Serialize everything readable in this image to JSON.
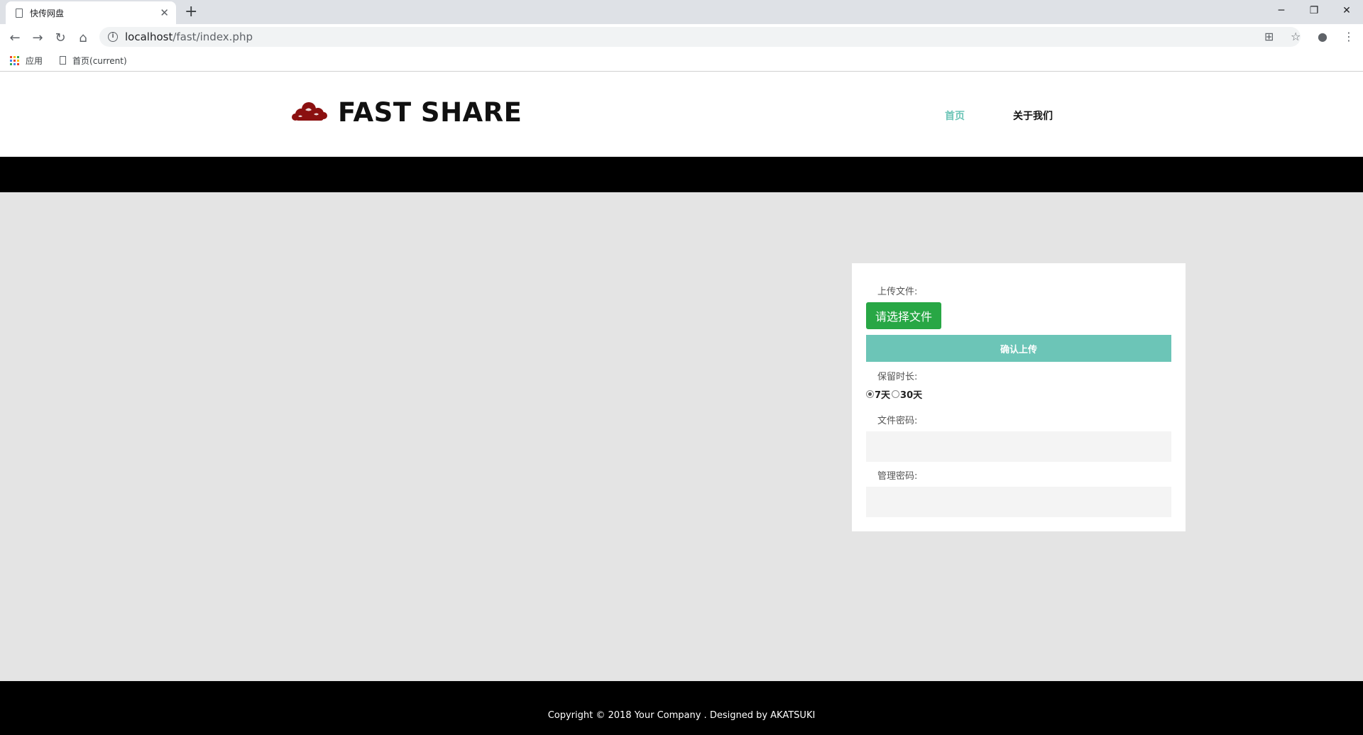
{
  "browser": {
    "tab_title": "快传网盘",
    "tab_close": "✕",
    "new_tab": "+",
    "window_controls": {
      "minimize": "─",
      "restore": "❐",
      "close": "✕"
    },
    "nav": {
      "back": "←",
      "forward": "→",
      "reload": "↻",
      "home": "⌂"
    },
    "url_host": "localhost",
    "url_path": "/fast/index.php",
    "info_glyph": "i",
    "toolbar_icons": {
      "translate": "⊞",
      "star": "☆",
      "account": "●",
      "menu": "⋮"
    },
    "bookmarks": [
      {
        "label": "应用"
      },
      {
        "label": "首页(current)"
      }
    ],
    "apps_colors": [
      "#ea4335",
      "#fbbc05",
      "#34a853",
      "#4285f4",
      "#ea4335",
      "#fbbc05",
      "#34a853",
      "#4285f4",
      "#ea4335"
    ]
  },
  "header": {
    "brand": "FAST SHARE",
    "logo_color": "#8b1010",
    "nav": [
      {
        "label": "首页",
        "active": true
      },
      {
        "label": "关于我们",
        "active": false
      }
    ],
    "accent": "#6cc5b7"
  },
  "upload_form": {
    "upload_label": "上传文件:",
    "choose_button": "请选择文件",
    "confirm_button": "确认上传",
    "duration_label": "保留时长:",
    "duration_options": [
      {
        "label": "7天",
        "checked": true
      },
      {
        "label": "30天",
        "checked": false
      }
    ],
    "file_password_label": "文件密码:",
    "file_password_value": "",
    "admin_password_label": "管理密码:",
    "admin_password_value": "",
    "choose_color": "#28a745",
    "confirm_color": "#6cc5b7"
  },
  "footer": {
    "copyright": "Copyright © 2018 Your Company . Designed by AKATSUKI"
  }
}
